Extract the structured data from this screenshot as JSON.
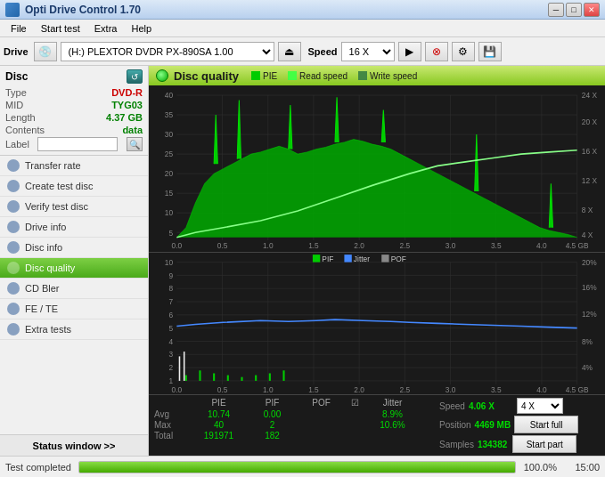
{
  "titlebar": {
    "title": "Opti Drive Control 1.70",
    "icon": "app-icon",
    "minimize_label": "─",
    "restore_label": "□",
    "close_label": "✕"
  },
  "menubar": {
    "items": [
      "File",
      "Start test",
      "Extra",
      "Help"
    ]
  },
  "toolbar": {
    "drive_label": "Drive",
    "drive_value": "(H:)  PLEXTOR DVDR   PX-890SA 1.00",
    "speed_label": "Speed",
    "speed_value": "16 X",
    "eject_icon": "⏏",
    "refresh_icon": "↺"
  },
  "disc_panel": {
    "title": "Disc",
    "refresh_icon": "↺",
    "type_label": "Type",
    "type_value": "DVD-R",
    "mid_label": "MID",
    "mid_value": "TYG03",
    "length_label": "Length",
    "length_value": "4.37 GB",
    "contents_label": "Contents",
    "contents_value": "data",
    "label_label": "Label",
    "label_value": "",
    "label_icon": "🔍"
  },
  "sidebar": {
    "items": [
      {
        "id": "transfer-rate",
        "label": "Transfer rate",
        "active": false
      },
      {
        "id": "create-test-disc",
        "label": "Create test disc",
        "active": false
      },
      {
        "id": "verify-test-disc",
        "label": "Verify test disc",
        "active": false
      },
      {
        "id": "drive-info",
        "label": "Drive info",
        "active": false
      },
      {
        "id": "disc-info",
        "label": "Disc info",
        "active": false
      },
      {
        "id": "disc-quality",
        "label": "Disc quality",
        "active": true
      },
      {
        "id": "cd-bler",
        "label": "CD Bler",
        "active": false
      },
      {
        "id": "fe-te",
        "label": "FE / TE",
        "active": false
      },
      {
        "id": "extra-tests",
        "label": "Extra tests",
        "active": false
      }
    ],
    "status_window_label": "Status window >>"
  },
  "chart": {
    "title": "Disc quality",
    "legend": [
      {
        "id": "pie",
        "label": "PIE",
        "color": "#00cc00"
      },
      {
        "id": "read-speed",
        "label": "Read speed",
        "color": "#44dd44"
      },
      {
        "id": "write-speed",
        "label": "Write speed",
        "color": "#448844"
      }
    ],
    "top": {
      "y_max": 40,
      "y_labels": [
        "40",
        "35",
        "30",
        "25",
        "20",
        "15",
        "10",
        "5"
      ],
      "x_labels": [
        "0.0",
        "0.5",
        "1.0",
        "1.5",
        "2.0",
        "2.5",
        "3.0",
        "3.5",
        "4.0",
        "4.5 GB"
      ],
      "right_labels": [
        "24 X",
        "20 X",
        "16 X",
        "12 X",
        "8 X",
        "4 X"
      ]
    },
    "bottom": {
      "y_max": 10,
      "y_labels": [
        "10",
        "9",
        "8",
        "7",
        "6",
        "5",
        "4",
        "3",
        "2",
        "1"
      ],
      "x_labels": [
        "0.0",
        "0.5",
        "1.0",
        "1.5",
        "2.0",
        "2.5",
        "3.0",
        "3.5",
        "4.0",
        "4.5 GB"
      ],
      "right_labels": [
        "20%",
        "16%",
        "12%",
        "8%",
        "4%"
      ],
      "legend": [
        {
          "id": "pif",
          "label": "PIF",
          "color": "#00cc00"
        },
        {
          "id": "jitter",
          "label": "Jitter",
          "color": "#4488ff"
        },
        {
          "id": "pof",
          "label": "POF",
          "color": "#888888"
        }
      ]
    }
  },
  "stats": {
    "columns": [
      "PIE",
      "PIF",
      "POF",
      "",
      "Jitter"
    ],
    "rows": [
      {
        "label": "Avg",
        "pie": "10.74",
        "pif": "0.00",
        "pof": "",
        "jitter_label": "8.9%"
      },
      {
        "label": "Max",
        "pie": "40",
        "pif": "2",
        "pof": "",
        "jitter_label": "10.6%"
      },
      {
        "label": "Total",
        "pie": "191971",
        "pif": "182",
        "pof": "",
        "jitter_label": ""
      }
    ],
    "speed_label": "Speed",
    "speed_value": "4.06 X",
    "position_label": "Position",
    "position_value": "4469 MB",
    "samples_label": "Samples",
    "samples_value": "134382",
    "jitter_checked": true,
    "speed_select_value": "4 X",
    "start_full_label": "Start full",
    "start_part_label": "Start part"
  },
  "statusbar": {
    "status_text": "Test completed",
    "progress_pct": 100,
    "progress_text": "100.0%",
    "time_text": "15:00"
  }
}
